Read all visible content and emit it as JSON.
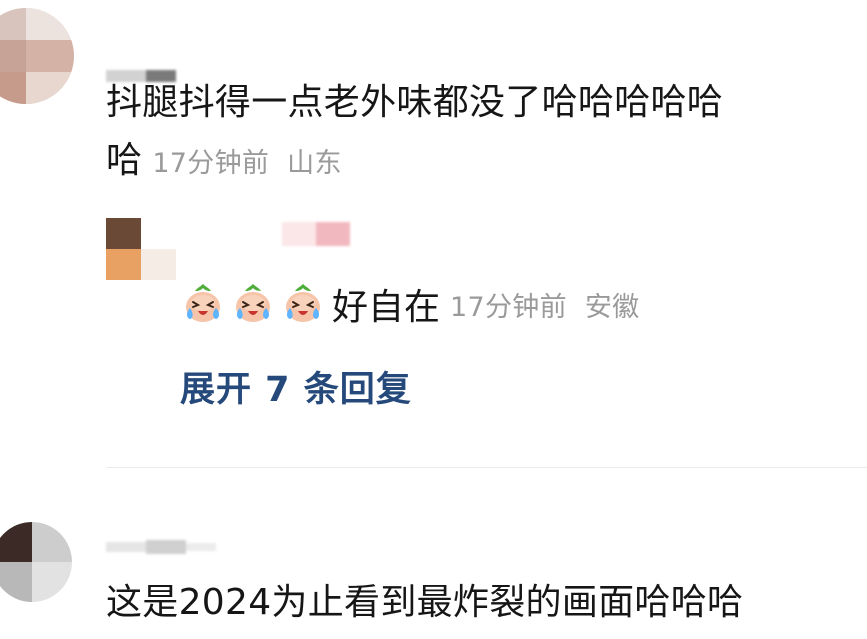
{
  "comments": [
    {
      "text_line1": "抖腿抖得一点老外味都没了哈哈哈哈哈",
      "text_line2": "哈",
      "time": "17分钟前",
      "location": "山东",
      "reply": {
        "text": "好自在",
        "time": "17分钟前",
        "location": "安徽",
        "emoji_icon": "crying-laughing-radish-icon",
        "emoji_count": 3
      },
      "expand_label": "展开 7 条回复"
    },
    {
      "text_line1": "这是2024为止看到最炸裂的画面哈哈哈"
    }
  ],
  "colors": {
    "text": "#161616",
    "meta": "#9a9a9a",
    "link": "#25497a",
    "divider": "#ececec"
  }
}
